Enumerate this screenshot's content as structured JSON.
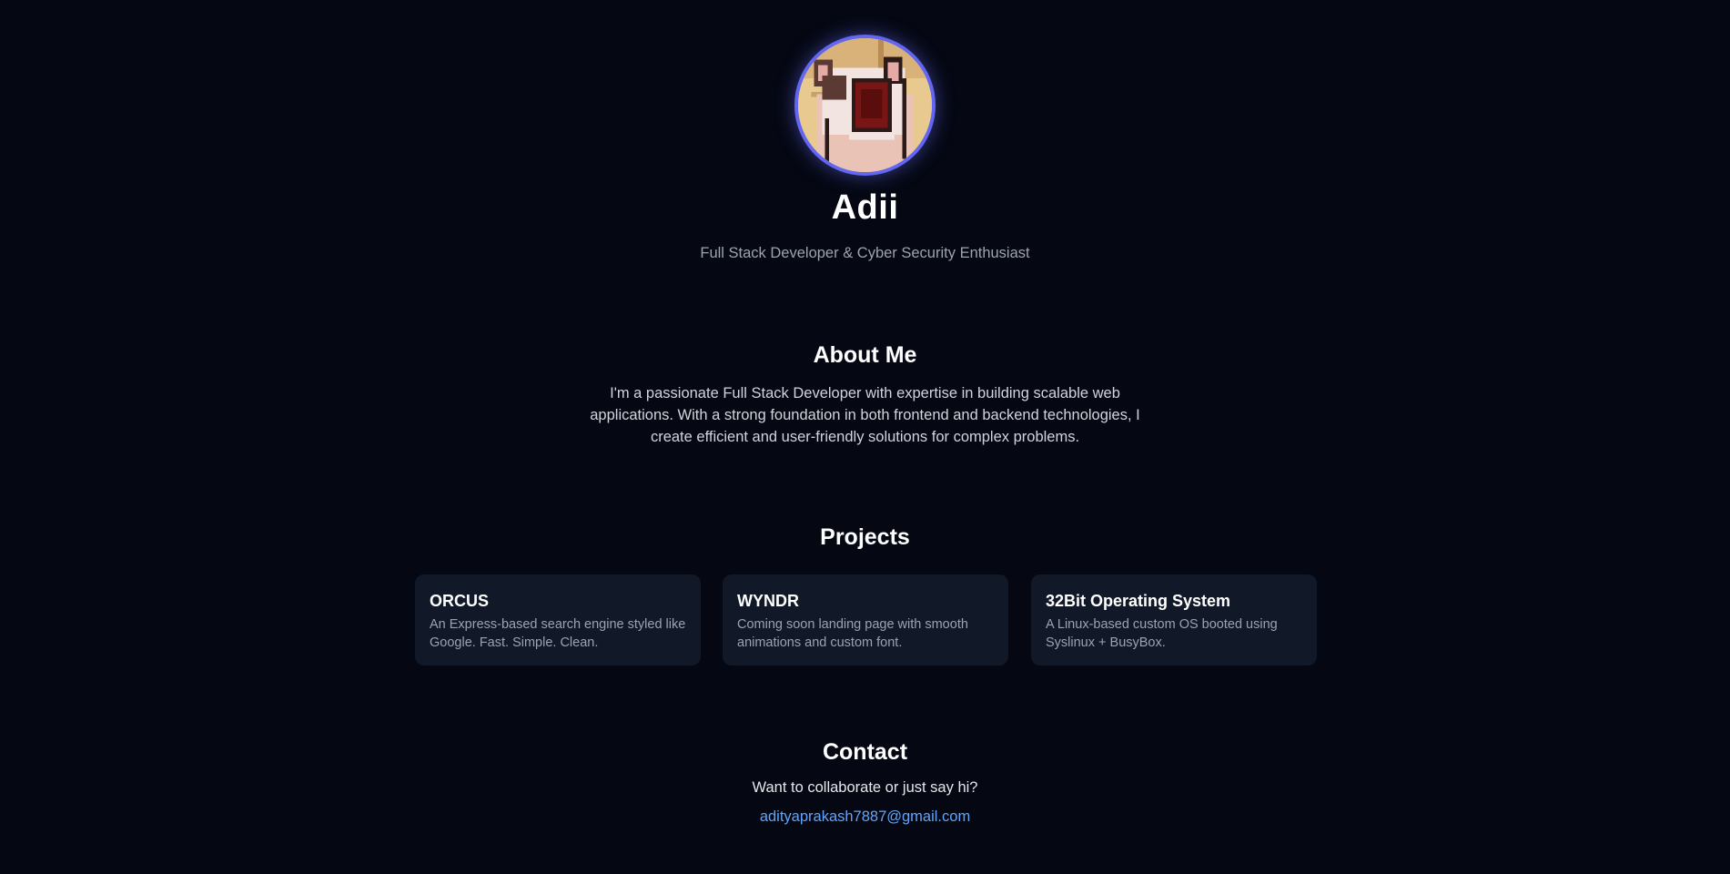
{
  "profile": {
    "avatar_icon": "cat-avatar-icon",
    "name": "Adii",
    "tagline": "Full Stack Developer & Cyber Security Enthusiast"
  },
  "about": {
    "title": "About Me",
    "text": "I'm a passionate Full Stack Developer with expertise in building scalable web applications. With a strong foundation in both frontend and backend technologies, I create efficient and user-friendly solutions for complex problems."
  },
  "projects": {
    "title": "Projects",
    "items": [
      {
        "title": "ORCUS",
        "description": "An Express-based search engine styled like Google. Fast. Simple. Clean."
      },
      {
        "title": "WYNDR",
        "description": "Coming soon landing page with smooth animations and custom font."
      },
      {
        "title": "32Bit Operating System",
        "description": "A Linux-based custom OS booted using Syslinux + BusyBox."
      }
    ]
  },
  "contact": {
    "title": "Contact",
    "text": "Want to collaborate or just say hi?",
    "email": "adityaprakash7887@gmail.com"
  },
  "colors": {
    "background": "#050813",
    "card": "#111827",
    "accent": "#6366f1",
    "link": "#60a5fa",
    "muted": "#9ca3af"
  }
}
